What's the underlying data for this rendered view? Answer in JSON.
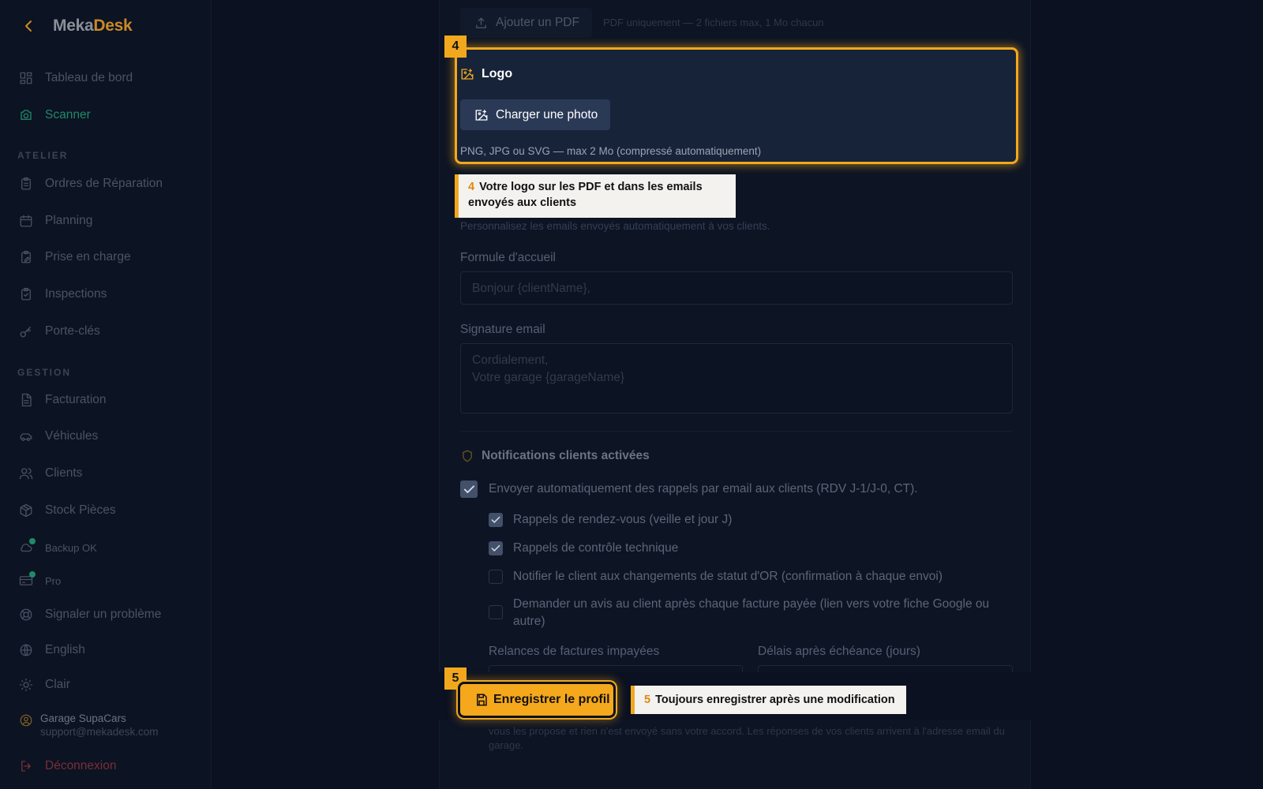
{
  "brand": {
    "part1": "Meka",
    "part2": "Desk"
  },
  "sidebar": {
    "top_items": [
      {
        "label": "Tableau de bord",
        "icon": "dashboard-icon"
      },
      {
        "label": "Scanner",
        "icon": "camera-icon",
        "active": true
      }
    ],
    "section_atelier": "ATELIER",
    "atelier_items": [
      {
        "label": "Ordres de Réparation",
        "icon": "clipboard-icon"
      },
      {
        "label": "Planning",
        "icon": "calendar-icon"
      },
      {
        "label": "Prise en charge",
        "icon": "clipboard-pen-icon"
      },
      {
        "label": "Inspections",
        "icon": "clipboard-check-icon"
      },
      {
        "label": "Porte-clés",
        "icon": "key-icon"
      }
    ],
    "section_gestion": "GESTION",
    "gestion_items": [
      {
        "label": "Facturation",
        "icon": "document-icon"
      },
      {
        "label": "Véhicules",
        "icon": "car-icon"
      },
      {
        "label": "Clients",
        "icon": "users-icon"
      },
      {
        "label": "Stock Pièces",
        "icon": "package-icon"
      }
    ],
    "status_items": [
      {
        "label": "Backup OK",
        "icon": "cloud-icon"
      },
      {
        "label": "Pro",
        "icon": "credit-card-icon"
      }
    ],
    "utility_items": [
      {
        "label": "Signaler un problème",
        "icon": "lifebuoy-icon"
      },
      {
        "label": "English",
        "icon": "globe-icon"
      },
      {
        "label": "Clair",
        "icon": "sun-icon"
      }
    ],
    "user": {
      "name": "Garage SupaCars",
      "email": "support@mekadesk.com"
    },
    "logout": "Déconnexion"
  },
  "main": {
    "pdf_button": "Ajouter un PDF",
    "pdf_hint": "PDF uniquement — 2 fichiers max, 1 Mo chacun",
    "step4_badge": "4",
    "logo_title": "Logo",
    "photo_button": "Charger une photo",
    "photo_hint": "PNG, JPG ou SVG — max 2 Mo (compressé automatiquement)",
    "tooltip4": {
      "num": "4",
      "text": "Votre logo sur les PDF et dans les emails envoyés aux clients"
    },
    "perso_hint": "Personnalisez les emails envoyés automatiquement à vos clients.",
    "greeting_label": "Formule d'accueil",
    "greeting_placeholder": "Bonjour {clientName},",
    "signature_label": "Signature email",
    "signature_line1": "Cordialement,",
    "signature_line2": "Votre garage {garageName}",
    "notif_title": "Notifications clients activées",
    "master_checkbox": "Envoyer automatiquement des rappels par email aux clients (RDV J-1/J-0, CT).",
    "options": [
      {
        "label": "Rappels de rendez-vous (veille et jour J)",
        "checked": true
      },
      {
        "label": "Rappels de contrôle technique",
        "checked": true
      },
      {
        "label": "Notifier le client aux changements de statut d'OR (confirmation à chaque envoi)",
        "checked": false
      },
      {
        "label": "Demander un avis au client après chaque facture payée (lien vers votre fiche Google ou autre)",
        "checked": false
      }
    ],
    "unpaid_label": "Relances de factures impayées",
    "delay_label": "Délais après échéance (jours)",
    "step5_badge": "5",
    "save_button": "Enregistrer le profil",
    "tooltip5": {
      "num": "5",
      "text": "Toujours enregistrer après une modification"
    },
    "foot_note": "vous les propose et rien n'est envoyé sans votre accord. Les réponses de vos clients arrivent à l'adresse email du garage."
  },
  "colors": {
    "accent": "#f2a81d",
    "active": "#1f8a6a",
    "danger": "#7a2f37",
    "background": "#0b1120"
  }
}
